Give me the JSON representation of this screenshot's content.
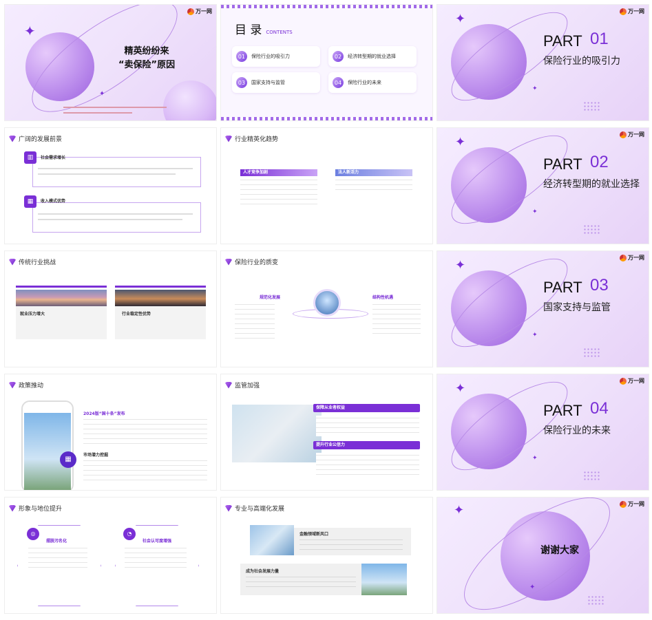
{
  "brand": {
    "logo_text": "万一网"
  },
  "cover": {
    "title_line1": "精英纷纷来",
    "title_line2": "“卖保险”原因"
  },
  "toc": {
    "title": "目 录",
    "subtitle": "CONTENTS",
    "items": [
      {
        "num": "01",
        "label": "保险行业的吸引力"
      },
      {
        "num": "02",
        "label": "经济转型期的就业选择"
      },
      {
        "num": "03",
        "label": "国家支持与监管"
      },
      {
        "num": "04",
        "label": "保险行业的未来"
      }
    ]
  },
  "parts": [
    {
      "word": "PART",
      "num": "01",
      "title": "保险行业的吸引力"
    },
    {
      "word": "PART",
      "num": "02",
      "title": "经济转型期的就业选择"
    },
    {
      "word": "PART",
      "num": "03",
      "title": "国家支持与监管"
    },
    {
      "word": "PART",
      "num": "04",
      "title": "保险行业的未来"
    }
  ],
  "s_prospects": {
    "header": "广阔的发展前景",
    "item1": "社会需求增长",
    "item2": "收入模式优势"
  },
  "s_trend": {
    "header": "行业精英化趋势",
    "tab1": "人才竞争加剧",
    "tab2": "法人新活力"
  },
  "s_challenge": {
    "header": "传统行业挑战",
    "card1": "就业压力增大",
    "card2": "行业稳定性优势"
  },
  "s_quality": {
    "header": "保险行业的质变",
    "left": "规范化发展",
    "right": "结构性机遇"
  },
  "s_policy": {
    "header": "政策推动",
    "heading1": "2024版“国十条”发布",
    "heading2": "市场潜力挖掘"
  },
  "s_regulation": {
    "header": "监管加强",
    "tab1": "保障从业者权益",
    "tab2": "提升行业公信力"
  },
  "s_image": {
    "header": "形象与地位提升",
    "left": "摆脱污名化",
    "right": "社会认可度增强"
  },
  "s_pro": {
    "header": "专业与高端化发展",
    "item1": "金融领域新风口",
    "item2": "成为社会发展力量"
  },
  "thanks": {
    "text": "谢谢大家"
  },
  "colors": {
    "accent": "#7a2fd6",
    "light": "#efe2fb"
  }
}
